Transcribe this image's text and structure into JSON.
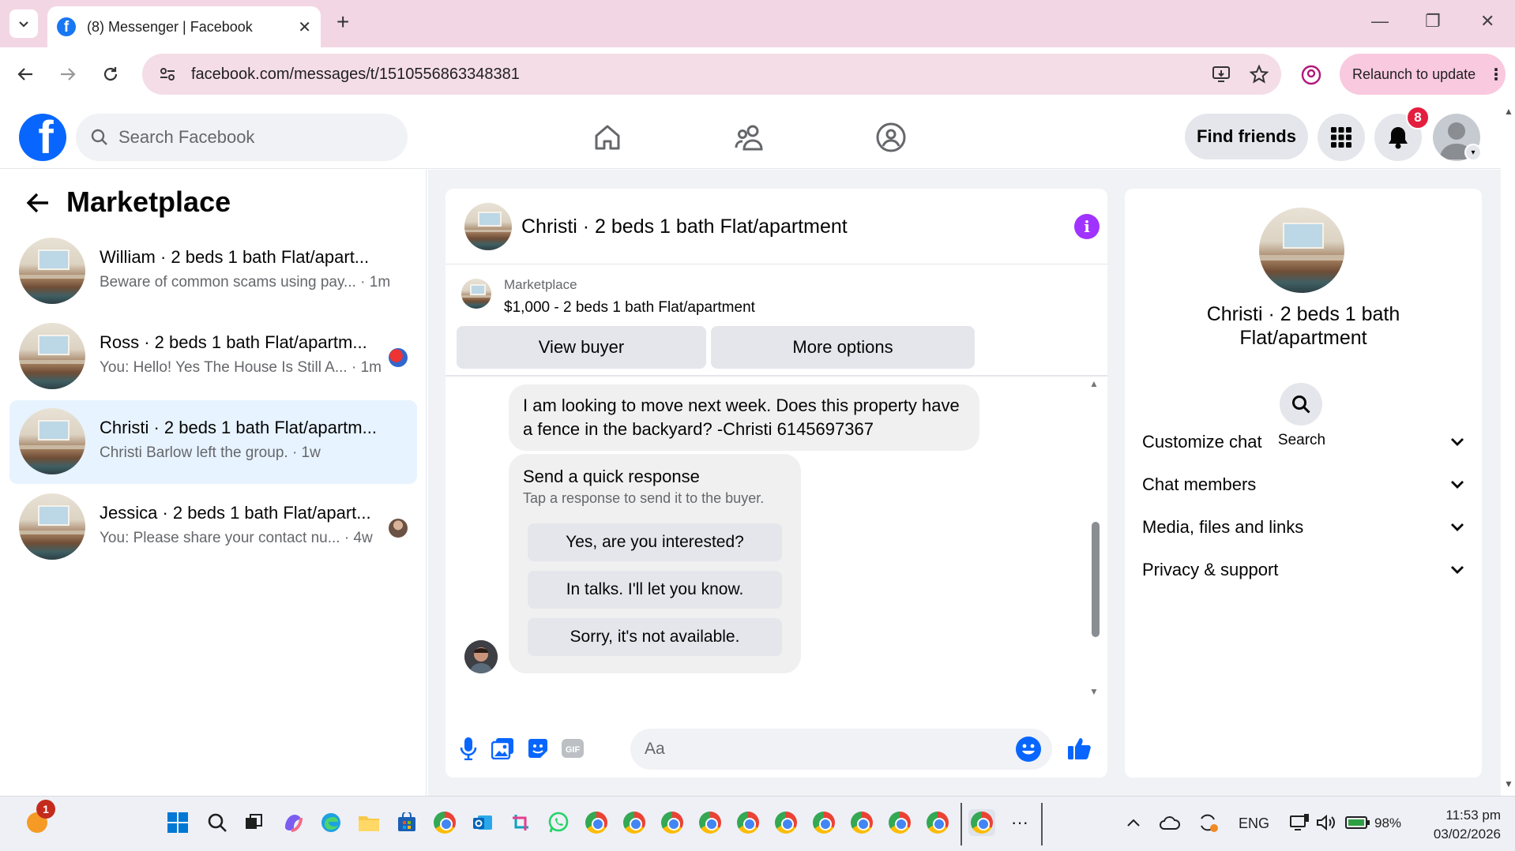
{
  "browser": {
    "tab_title": "(8) Messenger | Facebook",
    "url": "facebook.com/messages/t/1510556863348381",
    "relaunch_label": "Relaunch to update"
  },
  "facebook": {
    "search_placeholder": "Search Facebook",
    "find_friends": "Find friends",
    "notification_count": "8",
    "brand_color": "#0866ff"
  },
  "left_panel": {
    "title": "Marketplace",
    "conversations": [
      {
        "name": "William · 2 beds 1 bath Flat/apart...",
        "snippet": "Beware of common scams using pay... · 1m",
        "active": false
      },
      {
        "name": "Ross · 2 beds 1 bath Flat/apartm...",
        "snippet": "You: Hello! Yes The House Is Still A... · 1m",
        "active": false
      },
      {
        "name": "Christi · 2 beds 1 bath Flat/apartm...",
        "snippet": "Christi Barlow left the group. · 1w",
        "active": true
      },
      {
        "name": "Jessica · 2 beds 1 bath Flat/apart...",
        "snippet": "You: Please share your contact nu... · 4w",
        "active": false
      }
    ]
  },
  "chat": {
    "title": "Christi · 2 beds 1 bath Flat/apartment",
    "marketplace_label": "Marketplace",
    "listing": "$1,000 - 2 beds 1 bath Flat/apartment",
    "view_buyer": "View buyer",
    "more_options": "More options",
    "incoming_message": "I am looking to move next week. Does this property have a fence in the backyard? -Christi 6145697367",
    "quick_response": {
      "title": "Send a quick response",
      "subtitle": "Tap a response to send it to the buyer.",
      "options": [
        "Yes, are you interested?",
        "In talks. I'll let you know.",
        "Sorry, it's not available."
      ]
    },
    "composer_placeholder": "Aa"
  },
  "right_panel": {
    "name": "Christi · 2 beds 1 bath Flat/apartment",
    "search_label": "Search",
    "sections": [
      "Customize chat",
      "Chat members",
      "Media, files and links",
      "Privacy & support"
    ]
  },
  "taskbar": {
    "notification_badge": "1",
    "language": "ENG",
    "battery": "98%",
    "time": "11:53 pm",
    "date": "03/02/2026"
  }
}
